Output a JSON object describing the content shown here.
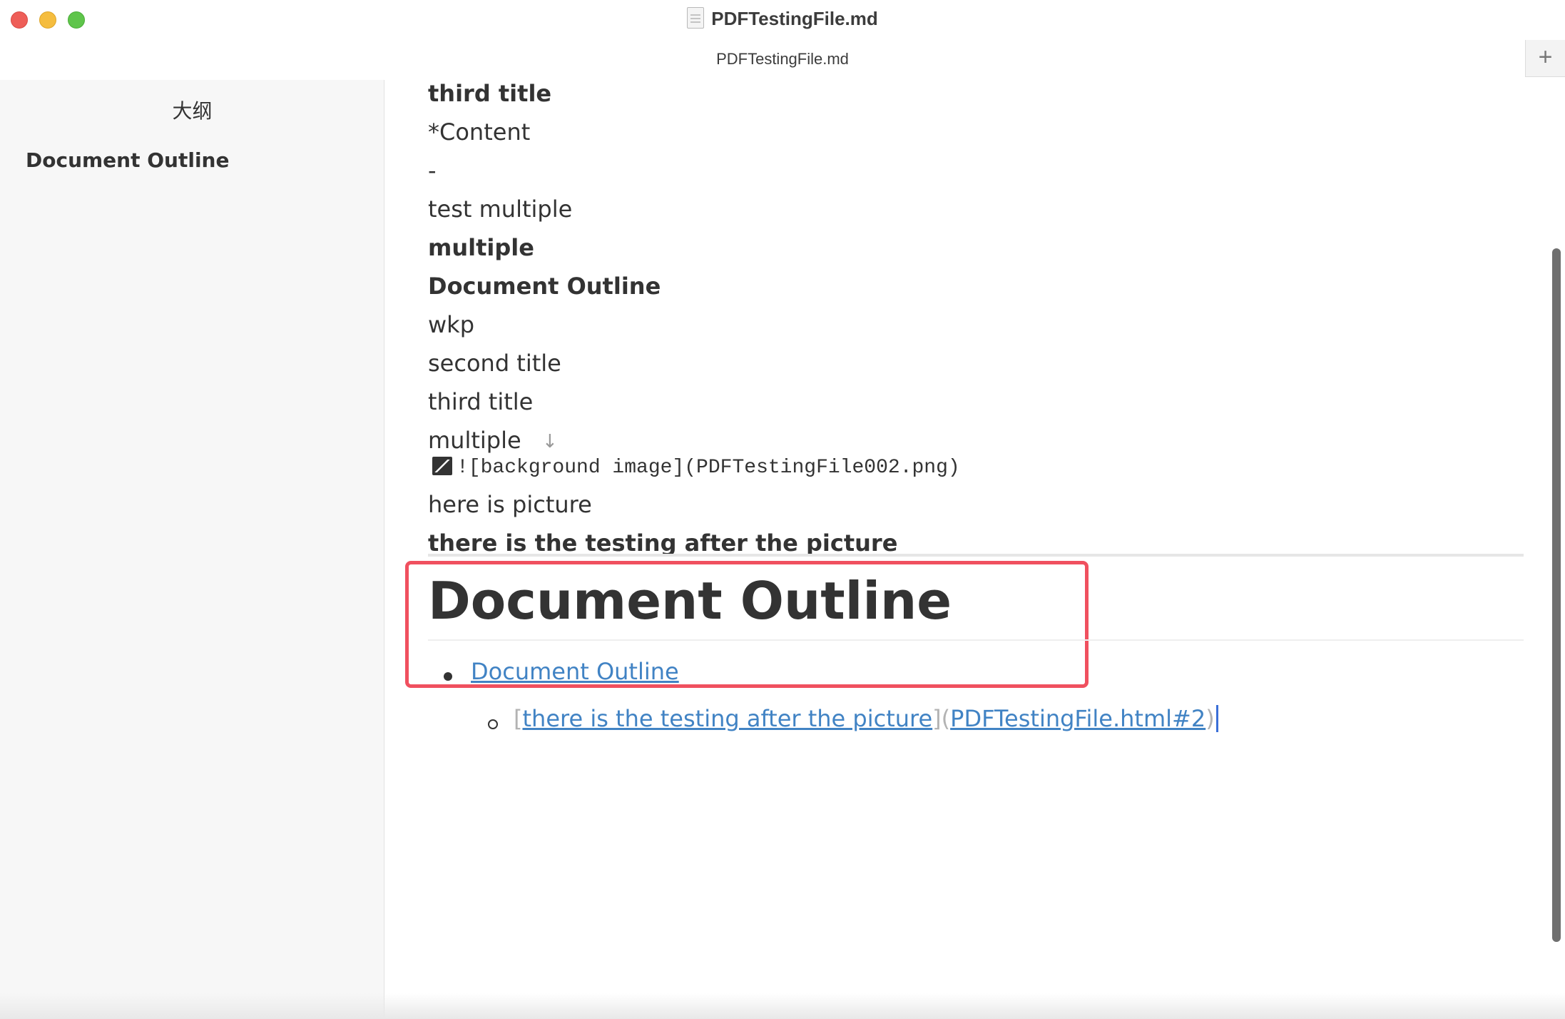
{
  "window": {
    "title": "PDFTestingFile.md",
    "tab": "PDFTestingFile.md",
    "new_tab_label": "+"
  },
  "sidebar": {
    "title": "大纲",
    "items": [
      {
        "label": "Document Outline"
      }
    ]
  },
  "editor": {
    "paragraphs": [
      "third title",
      "*Content",
      "-",
      "test multiple",
      "multiple",
      "Document Outline",
      "wkp",
      "second title",
      "third title",
      "multiple"
    ],
    "image_source": "![background image](PDFTestingFile002.png)",
    "after_image": "here is picture",
    "bold_line": "there is the testing after the picture",
    "heading": "Document Outline",
    "list": {
      "item1": "Document Outline",
      "sub_open": "[",
      "sub_text": "there is the testing after the picture",
      "sub_mid": "](",
      "sub_href": "PDFTestingFile.html#2",
      "sub_close": ")"
    },
    "arrow": "↓"
  },
  "colors": {
    "link": "#4183c4",
    "highlight_border": "#f0505f",
    "text": "#333333"
  }
}
